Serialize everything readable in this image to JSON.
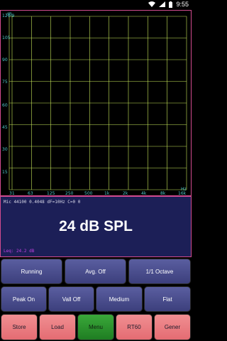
{
  "status": {
    "time": "9:55"
  },
  "plot": {
    "unit_y": "dB",
    "unit_x": "Hz",
    "y_axis_top_label": "121.9",
    "y_ticks": [
      "105",
      "90",
      "75",
      "60",
      "45",
      "30",
      "15"
    ],
    "x_ticks": [
      "31",
      "63",
      "125",
      "250",
      "500",
      "1k",
      "2k",
      "4k",
      "8k",
      "16k"
    ],
    "colors": {
      "grid": "#c8e85a",
      "labels": "#4ec8c8",
      "border": "#d24b8f"
    }
  },
  "spl_panel": {
    "info": "Mic 44100 0.4048 dF=10Hz C=0 0",
    "value": "24 dB SPL",
    "leq": "Leq: 24.2 dB"
  },
  "controls": {
    "row1": [
      "Running",
      "Avg. Off",
      "1/1 Octave"
    ],
    "row2": [
      "Peak On",
      "Vall Off",
      "Medium",
      "Flat"
    ],
    "row3": [
      "Store",
      "Load",
      "Menu",
      "RT60",
      "Gener"
    ]
  }
}
